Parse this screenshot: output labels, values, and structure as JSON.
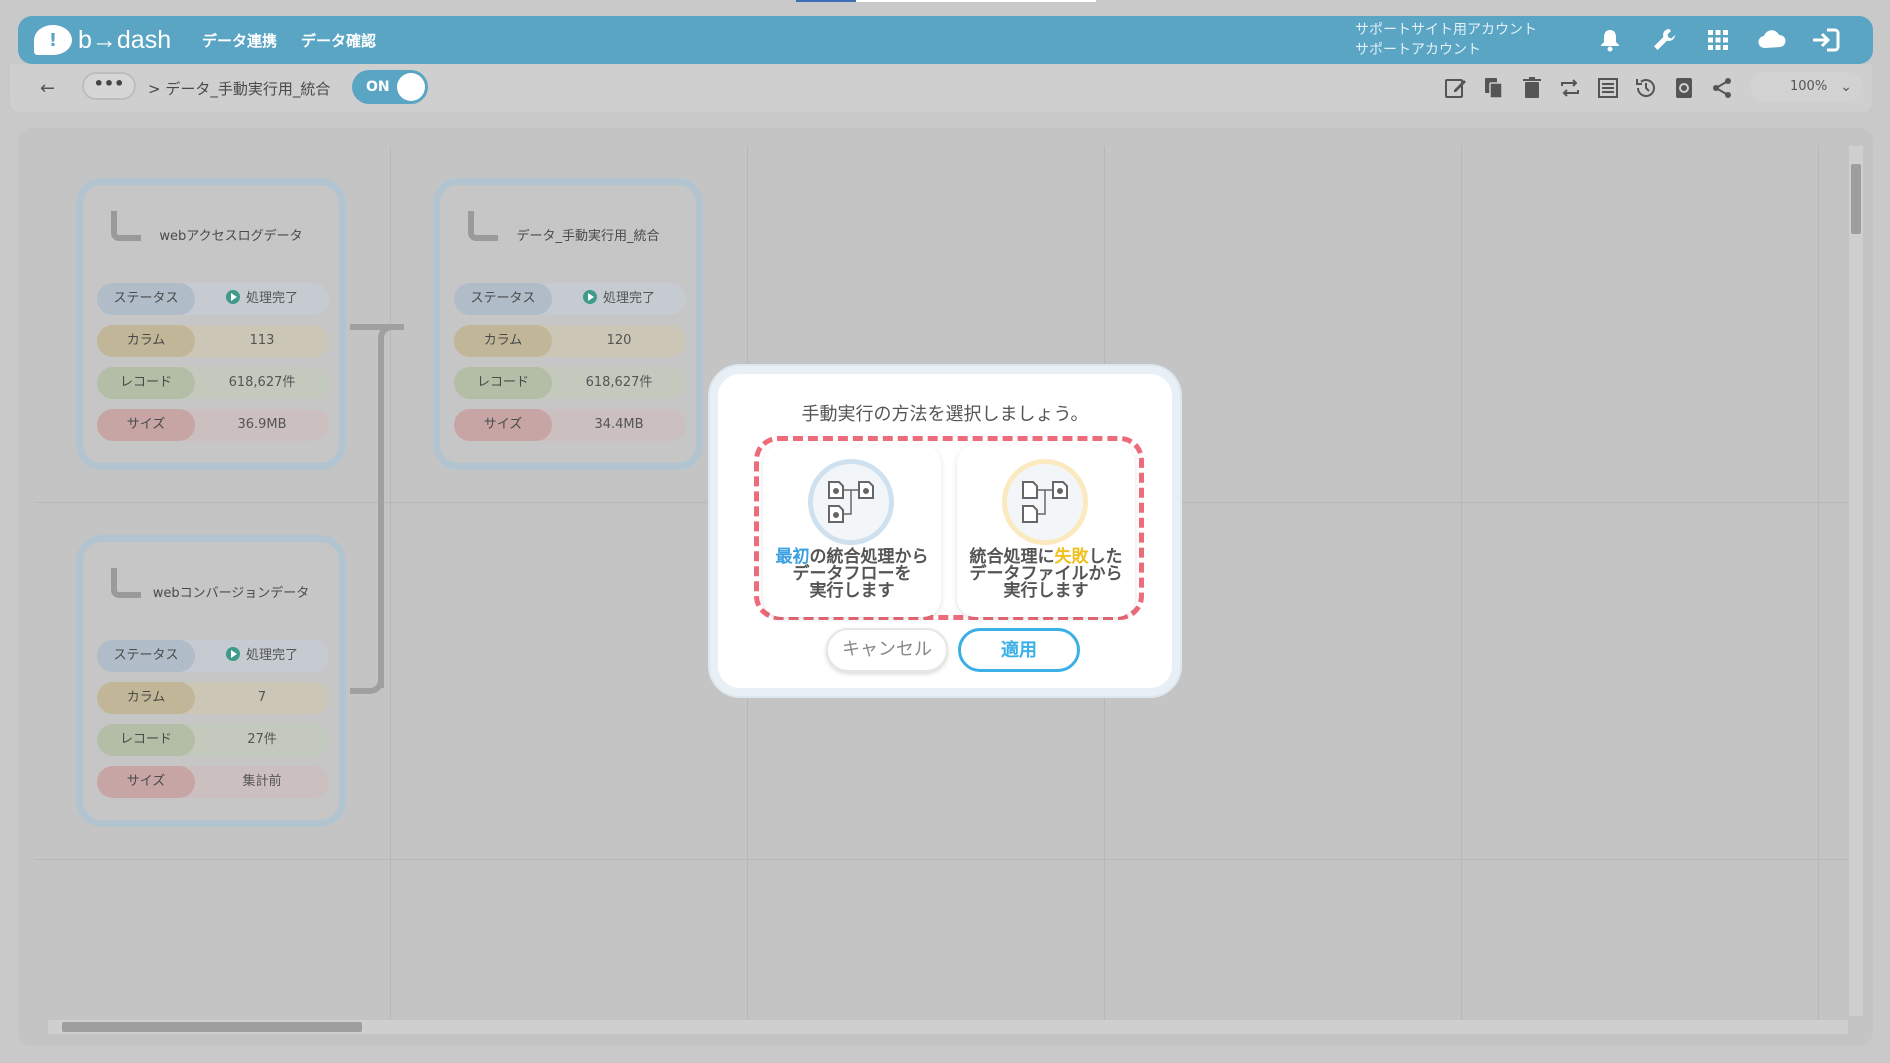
{
  "app": {
    "logo_text": "b→dash",
    "logo_mark": "!"
  },
  "nav": {
    "items": [
      "データ連携",
      "データ確認"
    ]
  },
  "account": {
    "line1": "サポートサイト用アカウント",
    "line2": "サポートアカウント"
  },
  "header_icons": [
    "bell-icon",
    "wrench-icon",
    "apps-grid-icon",
    "cloud-icon",
    "logout-icon"
  ],
  "toolbar": {
    "back": "←",
    "more": "•••",
    "breadcrumb": "> データ_手動実行用_統合",
    "toggle_label": "ON",
    "icons": [
      "edit-icon",
      "copy-icon",
      "trash-icon",
      "repeat-icon",
      "list-icon",
      "history-icon",
      "refresh-icon",
      "share-icon"
    ],
    "zoom": "100%"
  },
  "nodes": [
    {
      "title": "webアクセスログデータ",
      "rows": [
        {
          "label": "ステータス",
          "value": "処理完了"
        },
        {
          "label": "カラム",
          "value": "113"
        },
        {
          "label": "レコード",
          "value": "618,627件"
        },
        {
          "label": "サイズ",
          "value": "36.9MB"
        }
      ]
    },
    {
      "title": "データ_手動実行用_統合",
      "rows": [
        {
          "label": "ステータス",
          "value": "処理完了"
        },
        {
          "label": "カラム",
          "value": "120"
        },
        {
          "label": "レコード",
          "value": "618,627件"
        },
        {
          "label": "サイズ",
          "value": "34.4MB"
        }
      ]
    },
    {
      "title": "webコンバージョンデータ",
      "rows": [
        {
          "label": "ステータス",
          "value": "処理完了"
        },
        {
          "label": "カラム",
          "value": "7"
        },
        {
          "label": "レコード",
          "value": "27件"
        },
        {
          "label": "サイズ",
          "value": "集計前"
        }
      ]
    }
  ],
  "modal": {
    "heading": "手動実行の方法を選択しましょう。",
    "option1": {
      "highlight": "最初",
      "text_a": "の統合処理から",
      "text_b": "データフローを",
      "text_c": "実行します"
    },
    "option2": {
      "text_pre": "統合処理に",
      "highlight": "失敗",
      "text_post": "した",
      "text_b": "データファイルから",
      "text_c": "実行します"
    },
    "cancel": "キャンセル",
    "apply": "適用"
  }
}
